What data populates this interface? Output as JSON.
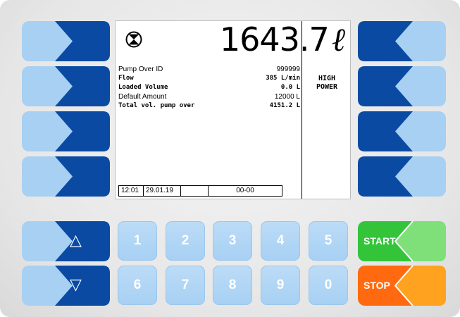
{
  "display": {
    "volume_value": "1643.7",
    "volume_unit": "ℓ",
    "flow_icon": "flow-meter-icon",
    "rows": [
      {
        "label": "Pump Over ID",
        "value": "999999",
        "style": "normal"
      },
      {
        "label": "Flow",
        "value": "385 L/min",
        "style": "mono"
      },
      {
        "label": "Loaded Volume",
        "value": "0.0 L",
        "style": "mono"
      },
      {
        "label": "Default Amount",
        "value": "12000 L",
        "style": "normal"
      },
      {
        "label": "Total vol. pump over",
        "value": "4151.2 L",
        "style": "mono"
      }
    ],
    "mode_line1": "HIGH",
    "mode_line2": "POWER",
    "status": {
      "time": "12:01",
      "date": "29.01.19",
      "blank": "",
      "code": "00-00"
    }
  },
  "keypad": {
    "keys": [
      "1",
      "2",
      "3",
      "4",
      "5",
      "6",
      "7",
      "8",
      "9",
      "0"
    ],
    "up_symbol": "△",
    "down_symbol": "▽",
    "start_label": "START",
    "stop_label": "STOP"
  },
  "colors": {
    "key_dark_blue": "#0a4aa3",
    "key_light_blue": "#a7d0f3",
    "start_green": "#2fb52f",
    "stop_orange": "#ff7a1a"
  }
}
